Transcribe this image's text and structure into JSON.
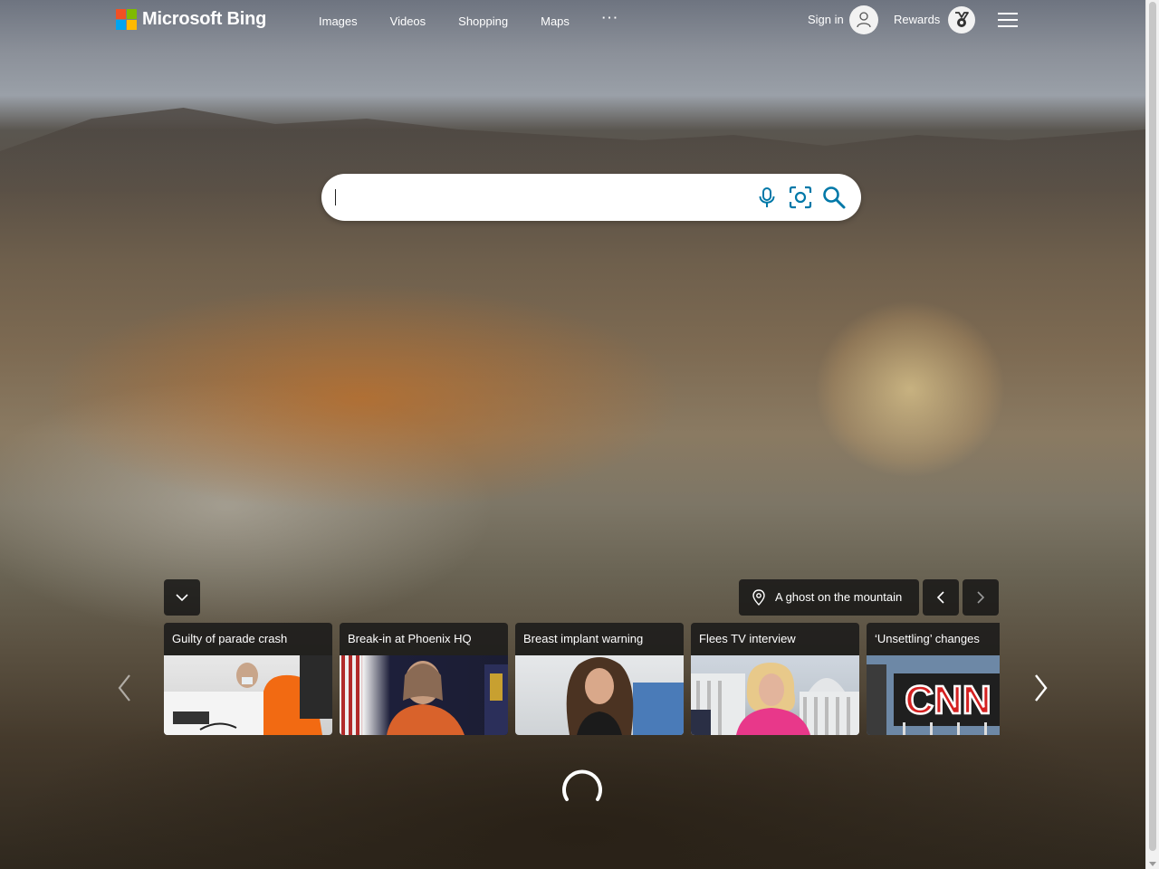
{
  "brand": {
    "logo_text": "Microsoft Bing"
  },
  "nav": {
    "items": [
      {
        "label": "Images"
      },
      {
        "label": "Videos"
      },
      {
        "label": "Shopping"
      },
      {
        "label": "Maps"
      }
    ],
    "more_label": "···"
  },
  "account": {
    "signin_label": "Sign in",
    "rewards_label": "Rewards"
  },
  "search": {
    "value": "",
    "placeholder": ""
  },
  "background": {
    "caption": "A ghost on the mountain"
  },
  "news": {
    "cards": [
      {
        "title": "Guilty of parade crash"
      },
      {
        "title": "Break-in at Phoenix HQ"
      },
      {
        "title": "Breast implant warning"
      },
      {
        "title": "Flees TV interview"
      },
      {
        "title": "‘Unsettling’ changes"
      }
    ]
  },
  "thumb_text": {
    "cnn": "CNN"
  },
  "colors": {
    "accent": "#0078a8",
    "search_bg": "#ffffff",
    "overlay": "#141414"
  }
}
